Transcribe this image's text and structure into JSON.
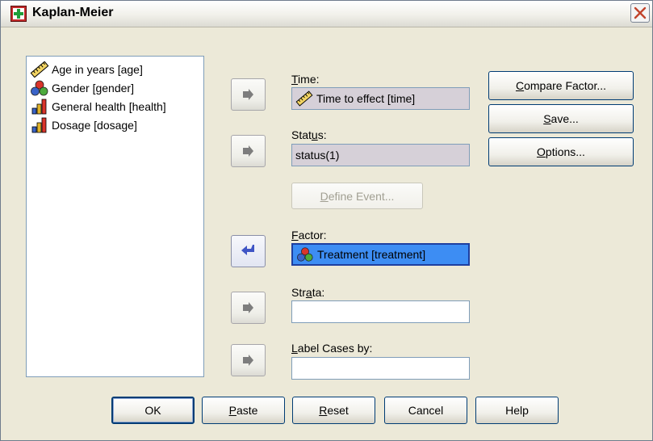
{
  "window": {
    "title": "Kaplan-Meier"
  },
  "variables": [
    {
      "label": "Age in years [age]",
      "icon": "ruler-scale-icon"
    },
    {
      "label": "Gender [gender]",
      "icon": "nominal-circles-icon"
    },
    {
      "label": "General health [health]",
      "icon": "ordinal-bars-icon"
    },
    {
      "label": "Dosage [dosage]",
      "icon": "ordinal-bars-icon"
    }
  ],
  "time": {
    "label_pre": "",
    "label_u": "T",
    "label_post": "ime:",
    "value": "Time to effect [time]"
  },
  "status": {
    "label_pre": "Stat",
    "label_u": "u",
    "label_post": "s:",
    "value": "status(1)"
  },
  "define_event": {
    "pre": "",
    "u": "D",
    "post": "efine Event..."
  },
  "factor": {
    "label_pre": "",
    "label_u": "F",
    "label_post": "actor:",
    "value": "Treatment [treatment]"
  },
  "strata": {
    "label_pre": "Str",
    "label_u": "a",
    "label_post": "ta:",
    "value": ""
  },
  "label_cases": {
    "label_pre": "",
    "label_u": "L",
    "label_post": "abel Cases by:",
    "value": ""
  },
  "side_buttons": {
    "compare": {
      "pre": "",
      "u": "C",
      "post": "ompare Factor..."
    },
    "save": {
      "pre": "",
      "u": "S",
      "post": "ave..."
    },
    "options": {
      "pre": "",
      "u": "O",
      "post": "ptions..."
    }
  },
  "bottom_buttons": {
    "ok": {
      "pre": "OK",
      "u": "",
      "post": ""
    },
    "paste": {
      "pre": "",
      "u": "P",
      "post": "aste"
    },
    "reset": {
      "pre": "",
      "u": "R",
      "post": "eset"
    },
    "cancel": {
      "pre": "Cancel",
      "u": "",
      "post": ""
    },
    "help": {
      "pre": "Help",
      "u": "",
      "post": ""
    }
  },
  "colors": {
    "selection": "#3d8df3",
    "dialog_bg": "#ece9d8",
    "field_filled": "#d6d0d8",
    "close_red": "#c1432b"
  }
}
